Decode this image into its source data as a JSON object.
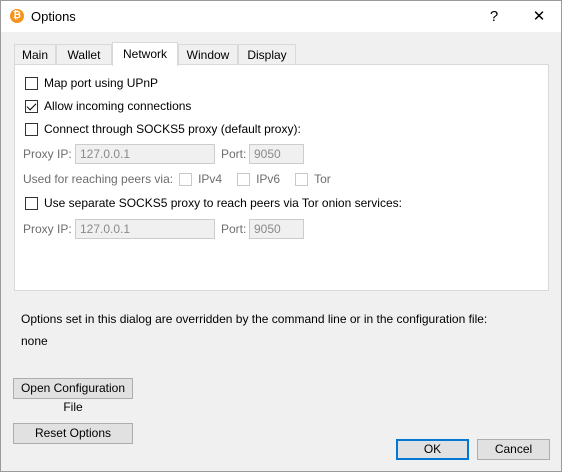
{
  "titlebar": {
    "icon": "bitcoin-icon",
    "title": "Options",
    "help": "?",
    "close": "✕"
  },
  "tabs": [
    {
      "label": "Main",
      "active": false
    },
    {
      "label": "Wallet",
      "active": false
    },
    {
      "label": "Network",
      "active": true
    },
    {
      "label": "Window",
      "active": false
    },
    {
      "label": "Display",
      "active": false
    }
  ],
  "network": {
    "upnp": {
      "label": "Map port using UPnP",
      "checked": false
    },
    "incoming": {
      "label": "Allow incoming connections",
      "checked": true
    },
    "socks5": {
      "label": "Connect through SOCKS5 proxy (default proxy):",
      "checked": false
    },
    "proxy": {
      "ip_label": "Proxy IP:",
      "ip_value": "127.0.0.1",
      "port_label": "Port:",
      "port_value": "9050"
    },
    "reaching": {
      "label": "Used for reaching peers via:",
      "ipv4": "IPv4",
      "ipv6": "IPv6",
      "tor": "Tor"
    },
    "separate_tor": {
      "label": "Use separate SOCKS5 proxy to reach peers via Tor onion services:",
      "checked": false
    },
    "tor_proxy": {
      "ip_label": "Proxy IP:",
      "ip_value": "127.0.0.1",
      "port_label": "Port:",
      "port_value": "9050"
    }
  },
  "override_notice": "Options set in this dialog are overridden by the command line or in the configuration file:",
  "override_value": "none",
  "buttons": {
    "open_config": "Open Configuration File",
    "reset": "Reset Options",
    "ok": "OK",
    "cancel": "Cancel"
  }
}
